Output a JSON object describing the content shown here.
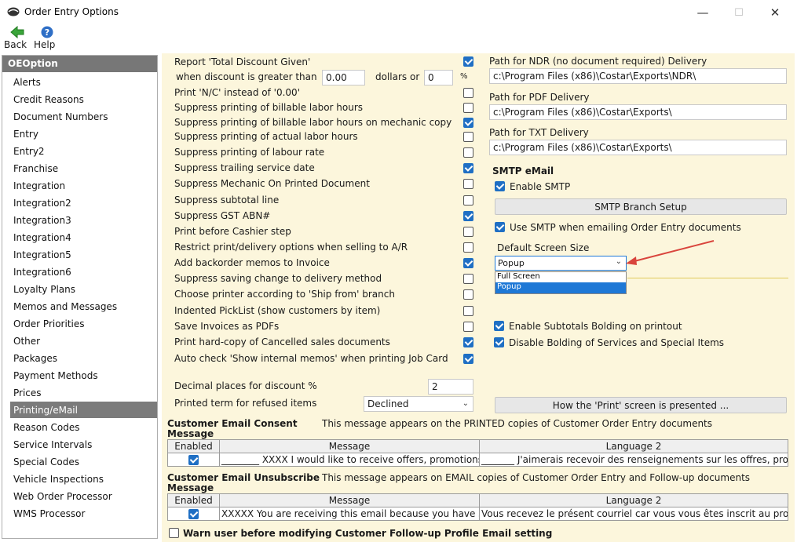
{
  "window": {
    "title": "Order Entry Options",
    "minimize": "—",
    "maximize": "☐",
    "close": "✕"
  },
  "toolbar": {
    "back_label": "Back",
    "help_label": "Help"
  },
  "sidebar": {
    "header": "OEOption",
    "items": [
      "Alerts",
      "Credit Reasons",
      "Document Numbers",
      "Entry",
      "Entry2",
      "Franchise",
      "Integration",
      "Integration2",
      "Integration3",
      "Integration4",
      "Integration5",
      "Integration6",
      "Loyalty Plans",
      "Memos and Messages",
      "Order Priorities",
      "Other",
      "Packages",
      "Payment Methods",
      "Prices",
      "Printing/eMail",
      "Reason Codes",
      "Service Intervals",
      "Special Codes",
      "Vehicle Inspections",
      "Web Order Processor",
      "WMS Processor"
    ],
    "selected": "Printing/eMail"
  },
  "discount": {
    "report_label": "Report 'Total Discount Given'",
    "report_checked": true,
    "when_label": "when discount is greater than",
    "amount_value": "0.00",
    "dollars_or_label": "dollars or",
    "percent_value": "0",
    "percent_sign": "%"
  },
  "options": [
    {
      "label": "Print 'N/C' instead of '0.00'",
      "checked": false
    },
    {
      "label": "Suppress printing of billable labor hours",
      "checked": false
    },
    {
      "label": "Suppress printing of billable labor hours on mechanic copy",
      "checked": true
    },
    {
      "label": "Suppress printing of actual labor hours",
      "checked": false
    },
    {
      "label": "Suppress printing of labour rate",
      "checked": false
    },
    {
      "label": "Suppress trailing service date",
      "checked": true
    },
    {
      "label": "Suppress Mechanic On Printed Document",
      "checked": false
    },
    {
      "label": "Suppress subtotal line",
      "checked": false
    },
    {
      "label": "Suppress GST ABN#",
      "checked": true
    },
    {
      "label": "Print before Cashier step",
      "checked": false
    },
    {
      "label": "Restrict print/delivery options when selling to A/R",
      "checked": false
    },
    {
      "label": "Add backorder memos to Invoice",
      "checked": true
    },
    {
      "label": "Suppress saving change to delivery method",
      "checked": false
    },
    {
      "label": "Choose printer according to 'Ship from' branch",
      "checked": false
    },
    {
      "label": "Indented PickList (show customers by item)",
      "checked": false
    },
    {
      "label": "Save Invoices as PDFs",
      "checked": false
    },
    {
      "label": "Print hard-copy of Cancelled sales documents",
      "checked": true
    },
    {
      "label": "Auto check 'Show internal memos' when printing Job Card",
      "checked": true
    }
  ],
  "decimal": {
    "label": "Decimal places for discount %",
    "value": "2"
  },
  "refused": {
    "label": "Printed term for refused items",
    "value": "Declined"
  },
  "paths": {
    "ndr_label": "Path for NDR (no document required) Delivery",
    "ndr_value": "c:\\Program Files (x86)\\Costar\\Exports\\NDR\\",
    "pdf_label": "Path for PDF  Delivery",
    "pdf_value": "c:\\Program Files (x86)\\Costar\\Exports\\",
    "txt_label": "Path for TXT Delivery",
    "txt_value": "c:\\Program Files (x86)\\Costar\\Exports\\"
  },
  "smtp": {
    "section_label": "SMTP eMail",
    "enable_label": "Enable SMTP",
    "enable_checked": true,
    "branch_setup_label": "SMTP Branch Setup",
    "use_label": "Use SMTP when emailing Order Entry documents",
    "use_checked": true,
    "screen_size_label": "Default Screen Size",
    "screen_size_value": "Popup",
    "screen_size_options": [
      "Full Screen",
      "Popup"
    ],
    "screen_size_highlighted": "Popup"
  },
  "bolding": {
    "subtotals_label": "Enable Subtotals Bolding on printout",
    "subtotals_checked": true,
    "services_label": "Disable Bolding of Services and Special Items",
    "services_checked": true
  },
  "print_screen_button": "How the 'Print' screen is presented ...",
  "consent": {
    "title_line1": "Customer Email Consent",
    "title_line2": "Message",
    "note": "This message appears on the PRINTED copies of Customer Order Entry documents",
    "columns": [
      "Enabled",
      "Message",
      "Language 2"
    ],
    "row": {
      "enabled": true,
      "message": "________ XXXX I would like to receive offers, promotions",
      "language2": "_______ J'aimerais recevoir des renseignements sur les offres, pro"
    }
  },
  "unsubscribe": {
    "title_line1": "Customer Email Unsubscribe",
    "title_line2": "Message",
    "note": "This message appears on EMAIL copies of Customer Order Entry and Follow-up documents",
    "columns": [
      "Enabled",
      "Message",
      "Language 2"
    ],
    "row": {
      "enabled": true,
      "message": "XXXXX You are receiving this email because you have su",
      "language2": "Vous recevez le présent courriel car vous vous êtes inscrit au progr"
    }
  },
  "warn": {
    "label": "Warn user before modifying Customer Follow-up Profile Email setting",
    "checked": false
  },
  "colors": {
    "panel_bg": "#fcf6dc",
    "checkbox_on": "#1f6fc4",
    "sidebar_header": "#777777",
    "selected_item": "#7b7b7b",
    "dropdown_highlight": "#1e78d6",
    "annotation_arrow": "#d9453d"
  }
}
